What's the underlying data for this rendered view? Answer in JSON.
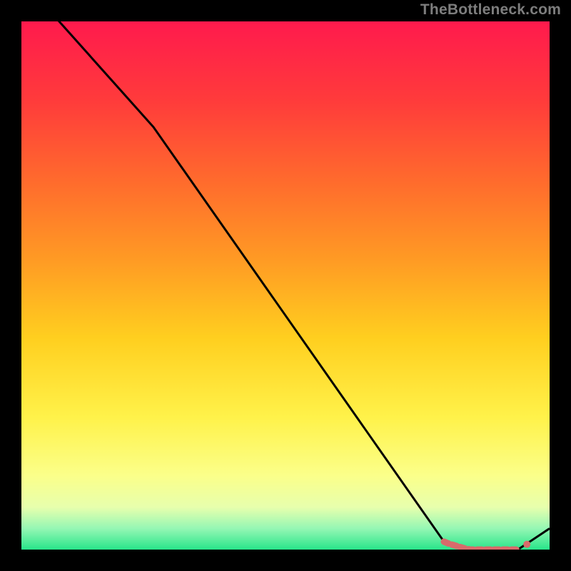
{
  "attribution": "TheBottleneck.com",
  "chart_data": {
    "type": "line",
    "title": "",
    "xlabel": "",
    "ylabel": "",
    "xlim": [
      0,
      100
    ],
    "ylim": [
      0,
      100
    ],
    "grid": false,
    "legend": false,
    "series": [
      {
        "name": "curve",
        "x": [
          0,
          25,
          80,
          85,
          94,
          100
        ],
        "y": [
          108,
          80,
          1.5,
          0,
          0,
          4
        ],
        "color": "#000000"
      }
    ],
    "markers": {
      "name": "highlight-region",
      "color": "#d86b6b",
      "points": [
        {
          "x": 80.0,
          "y": 1.5
        },
        {
          "x": 81.0,
          "y": 1.1
        },
        {
          "x": 82.0,
          "y": 0.8
        },
        {
          "x": 83.0,
          "y": 0.5
        },
        {
          "x": 84.0,
          "y": 0.2
        },
        {
          "x": 85.0,
          "y": 0.0
        },
        {
          "x": 86.5,
          "y": 0.0
        },
        {
          "x": 88.0,
          "y": 0.0
        },
        {
          "x": 89.5,
          "y": 0.0
        },
        {
          "x": 91.0,
          "y": 0.0
        },
        {
          "x": 92.5,
          "y": 0.0
        },
        {
          "x": 94.0,
          "y": 0.0
        }
      ]
    },
    "background_gradient": {
      "stops": [
        {
          "offset": 0.0,
          "color": "#ff1a4d"
        },
        {
          "offset": 0.15,
          "color": "#ff3b3b"
        },
        {
          "offset": 0.3,
          "color": "#ff6a2d"
        },
        {
          "offset": 0.45,
          "color": "#ff9a24"
        },
        {
          "offset": 0.6,
          "color": "#ffcf1f"
        },
        {
          "offset": 0.75,
          "color": "#fff24a"
        },
        {
          "offset": 0.86,
          "color": "#fbff8a"
        },
        {
          "offset": 0.92,
          "color": "#e7ffad"
        },
        {
          "offset": 0.96,
          "color": "#95f7b4"
        },
        {
          "offset": 1.0,
          "color": "#28e58a"
        }
      ]
    }
  }
}
